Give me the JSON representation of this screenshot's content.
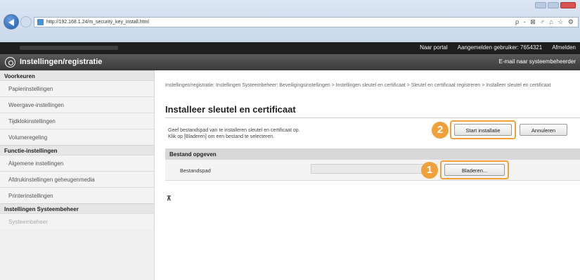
{
  "browser": {
    "url": "http://192.168.1.24/m_security_key_install.html",
    "tools_glyphs": "ρ - ⊠ ♂ ⌂ ☆ ⚙"
  },
  "topbar": {
    "portal": "Naar portal",
    "logged_in_label": "Aangemelden gebruiker:",
    "user_id": "7654321",
    "logout": "Afmelden"
  },
  "header": {
    "title": "Instellingen/registratie",
    "mail_link": "E-mail naar systeembeheerder"
  },
  "sidebar": {
    "groups": [
      {
        "label": "Voorkeuren"
      },
      {
        "label": "Functie-instellingen"
      },
      {
        "label": "Instellingen Systeembeheer"
      }
    ],
    "items": [
      {
        "label": "Papierinstellingen"
      },
      {
        "label": "Weergave-instellingen"
      },
      {
        "label": "Tijdklokinstellingen"
      },
      {
        "label": "Volumeregeling"
      },
      {
        "label": "Algemene instellingen"
      },
      {
        "label": "Afdrukinstellingen geheugenmedia"
      },
      {
        "label": "Printerinstellingen"
      },
      {
        "label": "Systeembeheer"
      }
    ]
  },
  "main": {
    "breadcrumb": "Instellingen/registratie: Instellingen Systeembeheer: Beveiligingsinstellingen > Instellingen sleutel en certificaat > Sleutel en certificaat registreren > Installeer sleutel en certificaat",
    "title": "Installeer sleutel en certificaat",
    "description_line1": "Geef bestandspad van te installeren sleutel en certificaat op.",
    "description_line2": "Klik op [Bladeren] om een bestand te selecteren.",
    "start_button": "Start installatie",
    "cancel_button": "Annuleren",
    "section_title": "Bestand opgeven",
    "path_label": "Bestandspad",
    "path_value": "",
    "browse_button": "Bladeren...",
    "step_1": "1",
    "step_2": "2",
    "top_glyph": "⊼"
  },
  "colors": {
    "highlight": "#f0a13a",
    "header_dark": "#1e1e1e"
  }
}
